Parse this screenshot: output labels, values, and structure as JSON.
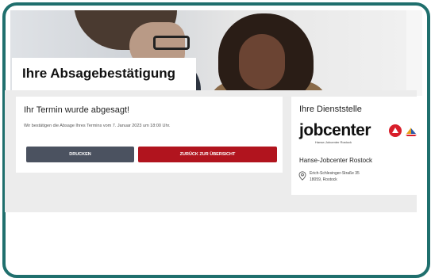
{
  "page": {
    "title": "Ihre Absagebestätigung"
  },
  "cancellation": {
    "heading": "Ihr Termin wurde abgesagt!",
    "message": "Wir bestätigen die Absage Ihres Termins vom 7. Januar 2023 um 18:00 Uhr.",
    "print_label": "DRUCKEN",
    "back_label": "ZURÜCK ZUR ÜBERSICHT"
  },
  "office": {
    "heading": "Ihre Dienststelle",
    "logo_text": "jobcenter",
    "logo_sub": "Hanse-Jobcenter Rostock",
    "name": "Hanse-Jobcenter Rostock",
    "street": "Erich-Schlesinger-Straße 35",
    "city": "18059, Rostock"
  },
  "colors": {
    "frame": "#1f6f6d",
    "print_button": "#4b5260",
    "back_button": "#b1141e",
    "logo_red": "#d81e2a"
  },
  "icons": [
    "location-pin-icon",
    "jobcenter-arrow-icon",
    "ship-logo-icon"
  ]
}
